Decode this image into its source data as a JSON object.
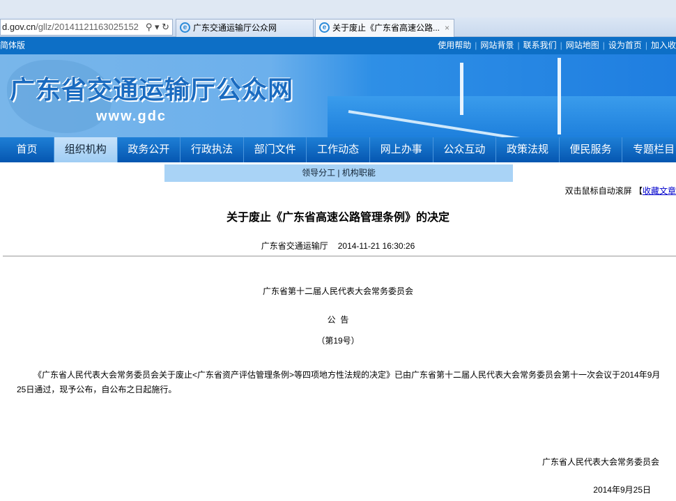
{
  "browser": {
    "address_host": "d.gov.cn",
    "address_path": "/gllz/20141121163025152",
    "address_icons": "⚲ ▾ ↻",
    "tabs": [
      {
        "label": "广东交通运输厅公众网"
      },
      {
        "label": "关于废止《广东省高速公路...",
        "close": "×"
      }
    ]
  },
  "topbar": {
    "left": "简体版",
    "links": [
      "使用帮助",
      "网站背景",
      "联系我们",
      "网站地图",
      "设为首页",
      "加入收"
    ]
  },
  "banner": {
    "title": "广东省交通运输厅公众网",
    "url": "www.gdc"
  },
  "nav": {
    "items": [
      "首页",
      "组织机构",
      "政务公开",
      "行政执法",
      "部门文件",
      "工作动态",
      "网上办事",
      "公众互动",
      "政策法规",
      "便民服务",
      "专题栏目"
    ],
    "active": 1
  },
  "submenu": {
    "items": [
      "领导分工",
      "机构职能"
    ],
    "sep": " | "
  },
  "scroll": {
    "text": "双击鼠标自动滚屏",
    "bracket": "【",
    "link": "收藏文章"
  },
  "article": {
    "title": "关于废止《广东省高速公路管理条例》的决定",
    "source": "广东省交通运输厅",
    "datetime": "2014-11-21 16:30:26",
    "org": "广东省第十二届人民代表大会常务委员会",
    "notice": "公  告",
    "number": "（第19号）",
    "body": "《广东省人民代表大会常务委员会关于废止<广东省资产评估管理条例>等四项地方性法规的决定》已由广东省第十二届人民代表大会常务委员会第十一次会议于2014年9月25日通过，现予公布，自公布之日起施行。",
    "signature": "广东省人民代表大会常务委员会",
    "date": "2014年9月25日"
  }
}
